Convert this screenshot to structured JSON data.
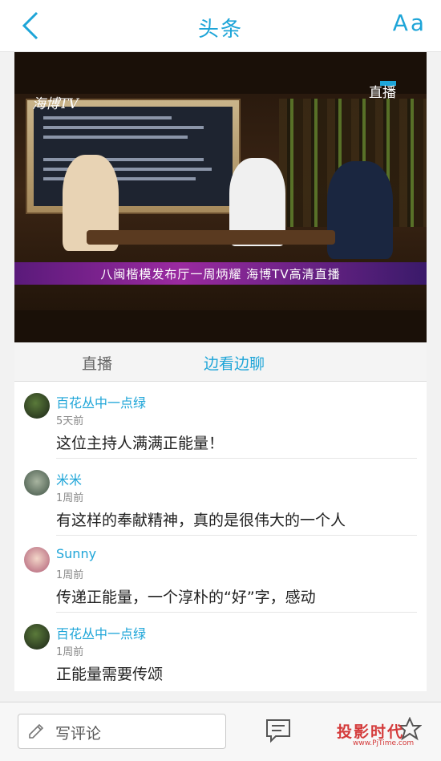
{
  "header": {
    "title": "头条",
    "font_label": "Aa",
    "back_icon": "chevron-left-icon"
  },
  "video": {
    "logo": "海博TV",
    "live_badge": "直播",
    "caption": "八闽楷模发布厅一周炳耀  海博TV高清直播"
  },
  "tabs": [
    {
      "label": "直播",
      "active": false
    },
    {
      "label": "边看边聊",
      "active": true
    }
  ],
  "comments": [
    {
      "name": "百花丛中一点绿",
      "time": "5天前",
      "text": "这位主持人满满正能量！"
    },
    {
      "name": "米米",
      "time": "1周前",
      "text": "有这样的奉献精神，真的是很伟大的一个人"
    },
    {
      "name": "Sunny",
      "time": "1周前",
      "text": "传递正能量，一个淳朴的“好”字，感动"
    },
    {
      "name": "百花丛中一点绿",
      "time": "1周前",
      "text": "正能量需要传颂"
    }
  ],
  "bottom": {
    "comment_placeholder": "写评论",
    "watermark": "投影时代",
    "watermark_url": "www.PjTime.com"
  },
  "colors": {
    "accent": "#1ea5d8",
    "watermark": "#d43a3a"
  }
}
